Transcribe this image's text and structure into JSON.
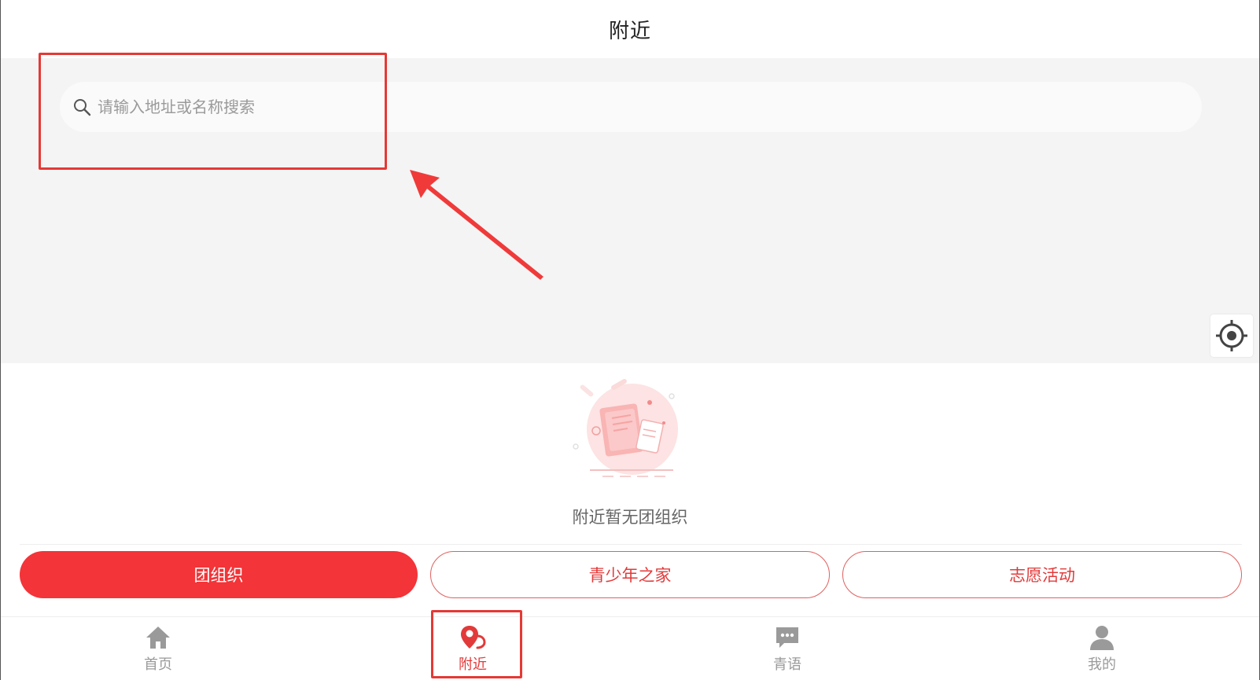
{
  "header": {
    "title": "附近"
  },
  "search": {
    "placeholder": "请输入地址或名称搜索",
    "icon": "search-icon"
  },
  "map": {
    "locate_icon": "crosshair-icon"
  },
  "empty_state": {
    "message": "附近暂无团组织"
  },
  "category_tabs": [
    {
      "label": "团组织",
      "active": true
    },
    {
      "label": "青少年之家",
      "active": false
    },
    {
      "label": "志愿活动",
      "active": false
    }
  ],
  "bottom_nav": [
    {
      "label": "首页",
      "icon": "home-icon",
      "active": false
    },
    {
      "label": "附近",
      "icon": "location-pin-icon",
      "active": true
    },
    {
      "label": "青语",
      "icon": "chat-bubble-icon",
      "active": false
    },
    {
      "label": "我的",
      "icon": "user-icon",
      "active": false
    }
  ],
  "colors": {
    "accent": "#f33438",
    "muted": "#9a9a9a",
    "annotation": "#e53935"
  }
}
